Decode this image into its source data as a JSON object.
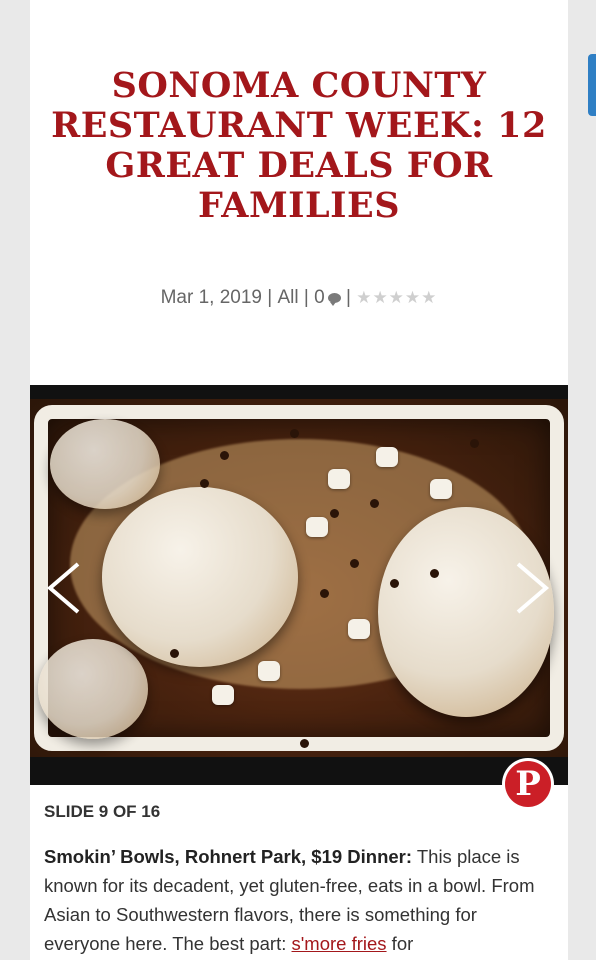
{
  "article": {
    "title": "SONOMA COUNTY RESTAURANT WEEK: 12 GREAT DEALS FOR FAMILIES",
    "date": "Mar 1, 2019",
    "separator": " | ",
    "category": "All",
    "comment_count": "0",
    "rating_stars": "★★★★★",
    "rating_value": 0
  },
  "slideshow": {
    "counter": "SLIDE 9 OF 16",
    "prev_icon": "chevron-left-icon",
    "next_icon": "chevron-right-icon",
    "pin_label": "P",
    "pin_icon": "pinterest-icon"
  },
  "slide": {
    "heading": "Smokin’ Bowls, Rohnert Park, $19 Dinner:",
    "text_before_link": " This place is known for its decadent, yet gluten-free, eats in a bowl. From Asian to Southwestern flavors, there is something for everyone here.  The best part: ",
    "link_text": "s'more fries",
    "text_after_link": " for"
  },
  "colors": {
    "title": "#a3171b",
    "accent_tab": "#2f7fc4",
    "pinterest": "#cb1f27"
  }
}
